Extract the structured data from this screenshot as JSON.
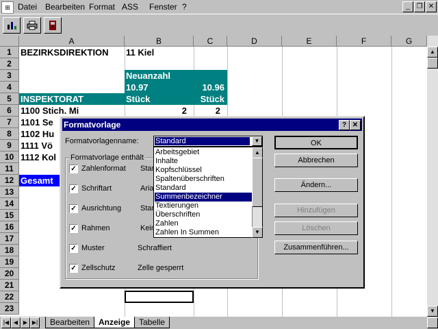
{
  "menu": {
    "items": [
      "Datei",
      "Bearbeiten",
      "Format",
      "ASS",
      "Fenster",
      "?"
    ]
  },
  "window_buttons": [
    "_",
    "❐",
    "✕"
  ],
  "sheet": {
    "columns": [
      "A",
      "B",
      "C",
      "D",
      "E",
      "F",
      "G"
    ],
    "rows": [
      "1",
      "2",
      "3",
      "4",
      "5",
      "6",
      "7",
      "8",
      "9",
      "10",
      "11",
      "12",
      "13",
      "14",
      "15",
      "16",
      "17",
      "18",
      "19",
      "20",
      "21",
      "22",
      "23"
    ],
    "cells": {
      "a1": "BEZIRKSDIREKTION",
      "b1": "11 Kiel",
      "b3": "Neuanzahl",
      "b4": "10.97",
      "c4": "10.96",
      "a5": "INSPEKTORAT",
      "b5": "Stück",
      "c5": "Stück",
      "a6": "1100 Stich. Mi",
      "b6": "2",
      "c6": "2",
      "a7": "1101 Se",
      "a8": "1102 Hu",
      "a9": "1111 Vö",
      "a10": "1112 Kol",
      "a12": "Gesamt"
    }
  },
  "tabs": [
    "Bearbeiten",
    "Anzeige",
    "Tabelle"
  ],
  "dialog": {
    "title": "Formatvorlage",
    "name_label": "Formatvorlagenname:",
    "selected": "Standard",
    "list": [
      "Arbeitsgebiet",
      "Inhalte",
      "Kopfschlüssel",
      "Spaltenüberschriften",
      "Standard",
      "Summenbezeichner",
      "Textierungen",
      "Überschriften",
      "Zahlen",
      "Zahlen In Summen"
    ],
    "highlighted": "Summenbezeichner",
    "group_label": "Formatvorlage enthält",
    "checks": [
      {
        "label": "Zahlenformat",
        "value": "Stan"
      },
      {
        "label": "Schriftart",
        "value": "Arial"
      },
      {
        "label": "Ausrichtung",
        "value": "Stan"
      },
      {
        "label": "Rahmen",
        "value": "Kein"
      },
      {
        "label": "Muster",
        "value": "Schraffiert"
      },
      {
        "label": "Zellschutz",
        "value": "Zelle gesperrt"
      }
    ],
    "buttons": {
      "ok": "OK",
      "cancel": "Abbrechen",
      "change": "Ändern...",
      "add": "Hinzufügen",
      "delete": "Löschen",
      "merge": "Zusammenführen..."
    }
  },
  "colors": {
    "teal": "#008080",
    "title_blue": "#000080",
    "highlight": "#0000ff"
  }
}
